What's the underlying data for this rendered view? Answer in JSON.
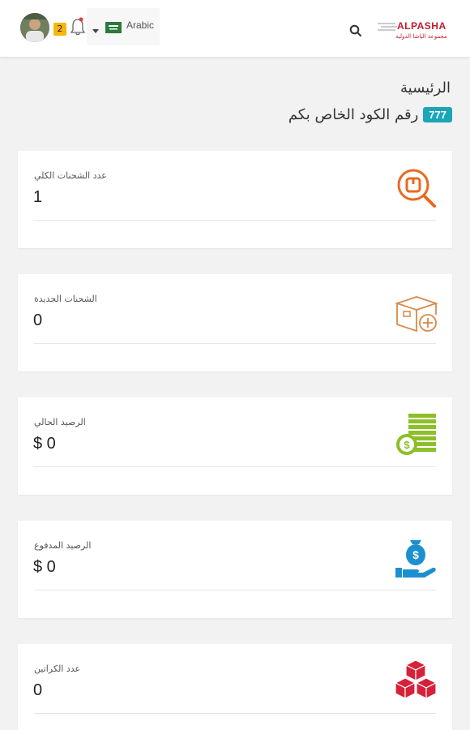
{
  "header": {
    "notification_count": "2",
    "language_label": "Arabic",
    "logo_text": "ALPASHA",
    "logo_subtitle": "مجموعة الباشا الدولية",
    "icons": [
      "avatar",
      "bell-icon",
      "caret-down-icon",
      "flag-icon",
      "search-icon",
      "logo"
    ]
  },
  "page": {
    "title": "الرئيسية",
    "code_label": "رقم الكود الخاص بكم",
    "code_value": "777"
  },
  "cards": [
    {
      "label": "عدد الشحنات الكلي",
      "value": "1",
      "icon": "search-box-icon",
      "color": "#e86a21"
    },
    {
      "label": "الشحنات الجديدة",
      "value": "0",
      "icon": "box-plus-icon",
      "color": "#d98a4a"
    },
    {
      "label": "الرصيد الحالي",
      "value": "$ 0",
      "icon": "coins-icon",
      "color": "#8cbf2a"
    },
    {
      "label": "الرصيد المدفوع",
      "value": "$ 0",
      "icon": "money-hand-icon",
      "color": "#1c8fd0"
    },
    {
      "label": "عدد الكراتين",
      "value": "0",
      "icon": "cubes-icon",
      "color": "#d6213a"
    }
  ],
  "colors": {
    "badge": "#1aa6b7",
    "notification": "#f5b70d",
    "brand": "#c31a2e"
  }
}
